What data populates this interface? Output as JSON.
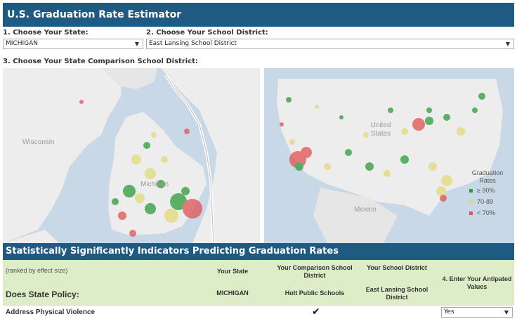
{
  "header": {
    "title": "U.S. Graduation Rate Estimator"
  },
  "selectors": {
    "state_label": "1. Choose Your State:",
    "state_value": "MICHIGAN",
    "district_label": "2. Choose Your School District:",
    "district_value": "East Lansing School District",
    "comparison_label": "3. Choose Your State Comparison School District:"
  },
  "maps": {
    "left_labels": {
      "wisconsin": "Wisconsin",
      "michigan": "Michigan"
    },
    "right_labels": {
      "united_states": "United States",
      "mexico": "Mexico"
    },
    "legend": {
      "title": "Graduation Rates",
      "items": [
        {
          "label": "≥ 90%",
          "color": "#2e9b3a"
        },
        {
          "label": "70-89",
          "color": "#e3d97a"
        },
        {
          "label": "< 70%",
          "color": "#e05252"
        }
      ]
    }
  },
  "indicators": {
    "title": "Statistically Significantly Indicators Predicting Graduation Rates",
    "ranked_note": "(ranked by effect size)",
    "policy_heading": "Does State Policy:",
    "columns": {
      "your_state": "Your State",
      "comparison": "Your Comparison School District",
      "your_district": "Your School District",
      "enter_values": "4. Enter Your Antipated Values"
    },
    "values": {
      "your_state": "MICHIGAN",
      "comparison": "Holt Public Schools",
      "your_district": "East Lansing School District"
    },
    "rows": [
      {
        "label": "Address Physical Violence",
        "check": "✔",
        "value": "Yes"
      }
    ]
  }
}
